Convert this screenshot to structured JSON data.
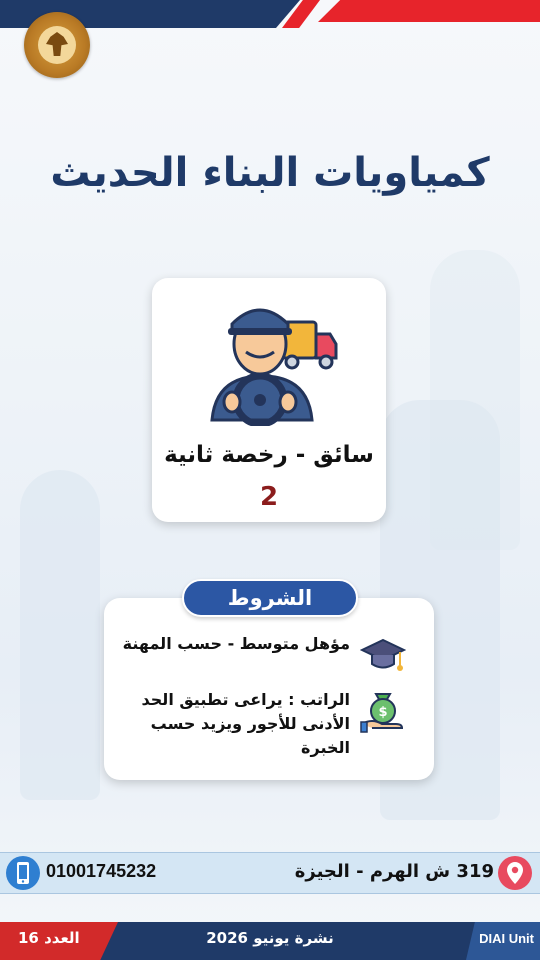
{
  "header": {
    "logo_alt": "Ministry of Labour"
  },
  "title": "كمياويات البناء الحديث",
  "job": {
    "name": "سائق - رخصة ثانية",
    "count": "2",
    "icon": "driver-truck-icon"
  },
  "conditions": {
    "header": "الشروط",
    "items": [
      {
        "text": "مؤهل متوسط - حسب المهنة",
        "icon": "graduation-cap-icon"
      },
      {
        "text": "الراتب : يراعى تطبيق الحد الأدنى للأجور ويزيد حسب الخبرة",
        "icon": "money-bag-icon"
      }
    ]
  },
  "contact": {
    "phone": "01001745232",
    "address": "319 ش الهرم - الجيزة"
  },
  "footer": {
    "issue": "العدد 16",
    "bulletin": "نشرة يونيو 2026",
    "unit": "DIAI Unit"
  },
  "colors": {
    "navy": "#1f3a68",
    "red": "#e7242b",
    "accent_blue": "#2c57a4",
    "count_red": "#8b1c1c"
  }
}
